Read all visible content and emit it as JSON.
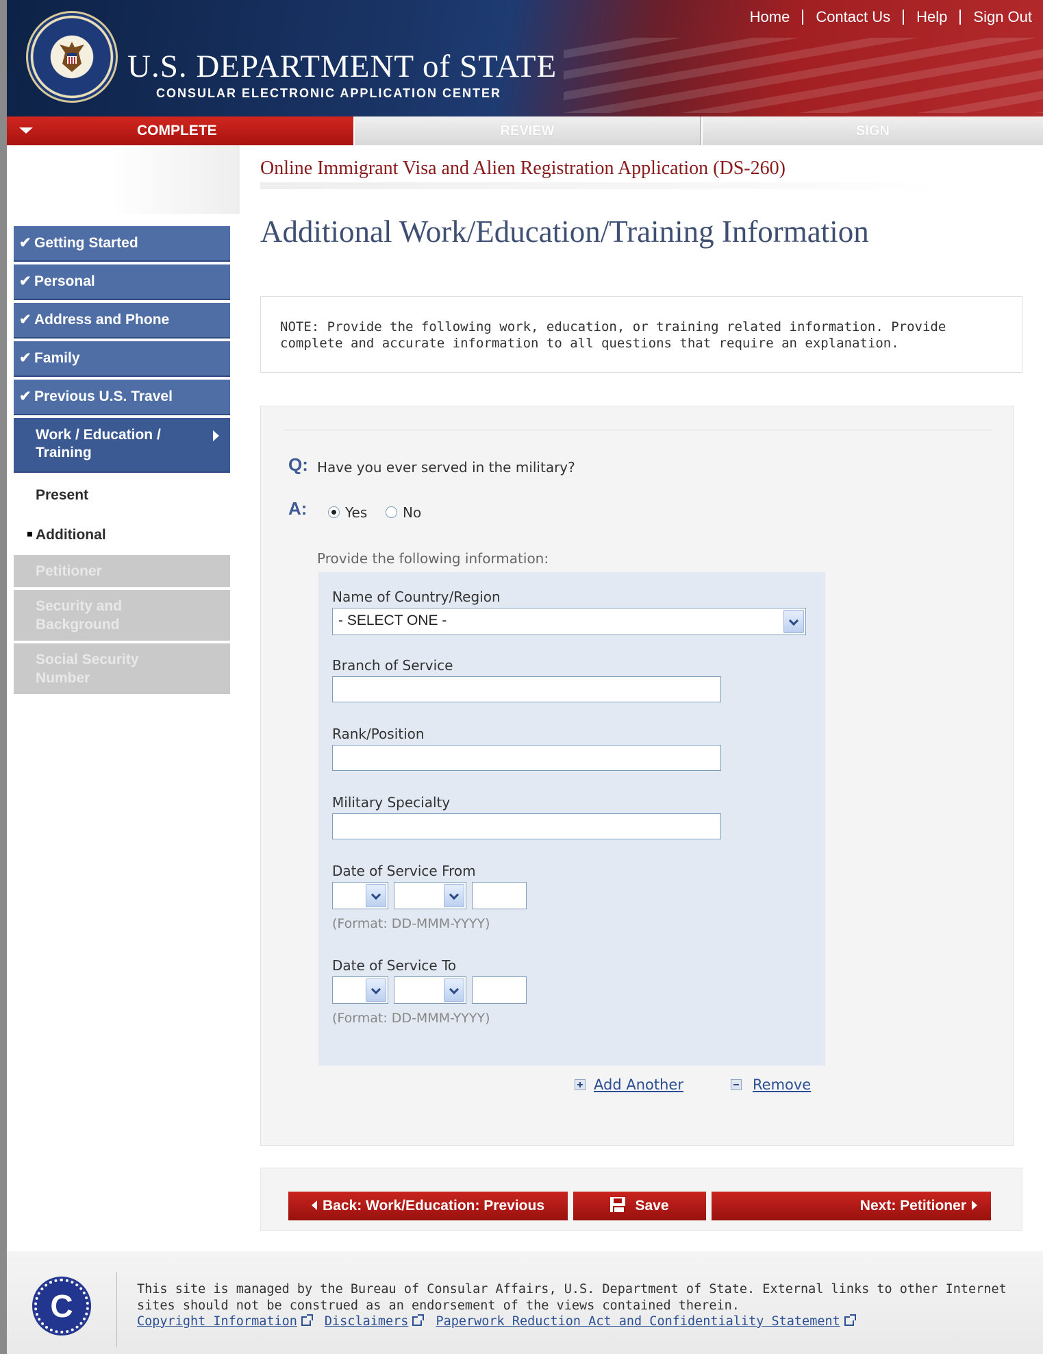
{
  "header": {
    "top_nav": [
      "Home",
      "Contact Us",
      "Help",
      "Sign Out"
    ],
    "brand_title": "U.S. DEPARTMENT of STATE",
    "brand_subtitle": "CONSULAR ELECTRONIC APPLICATION CENTER"
  },
  "progress": {
    "complete": "COMPLETE",
    "review": "REVIEW",
    "sign": "SIGN"
  },
  "sidebar": {
    "completed_items": [
      {
        "label": "Getting Started"
      },
      {
        "label": "Personal"
      },
      {
        "label": "Address and Phone"
      },
      {
        "label": "Family"
      },
      {
        "label": "Previous U.S. Travel"
      }
    ],
    "active_item": {
      "line1": "Work / Education /",
      "line2": "Training"
    },
    "sub_items": [
      "Present",
      "Additional"
    ],
    "disabled_items": [
      {
        "line1": "Petitioner",
        "line2": ""
      },
      {
        "line1": "Security and",
        "line2": "Background"
      },
      {
        "line1": "Social Security",
        "line2": "Number"
      }
    ]
  },
  "main": {
    "app_title": "Online Immigrant Visa and Alien Registration Application (DS-260)",
    "page_title": "Additional Work/Education/Training Information",
    "note_line1": "NOTE: Provide the following work, education, or training related information. Provide",
    "note_line2": "complete and accurate information to all questions that require an explanation.",
    "question_label": "Q:",
    "question": "Have you ever served in the military?",
    "answer_label": "A:",
    "answer_yes": "Yes",
    "answer_no": "No",
    "answer_selected": "Yes",
    "provide_info": "Provide the following information:",
    "fields": {
      "country_label": "Name of Country/Region",
      "country_value": "- SELECT ONE -",
      "branch_label": "Branch of Service",
      "branch_value": "",
      "rank_label": "Rank/Position",
      "rank_value": "",
      "specialty_label": "Military Specialty",
      "specialty_value": "",
      "from_label": "Date of Service From",
      "from_format": "(Format: DD-MMM-YYYY)",
      "to_label": "Date of Service To",
      "to_format": "(Format: DD-MMM-YYYY)"
    },
    "add_another": "Add Another",
    "remove": "Remove"
  },
  "buttons": {
    "back": "Back: Work/Education: Previous",
    "save": "Save",
    "next": "Next: Petitioner"
  },
  "footer": {
    "logo_letter": "C",
    "line1": "This site is managed by the Bureau of Consular Affairs, U.S. Department of State. External links to other Internet",
    "line2": "sites should not be construed as an endorsement of the views contained therein.",
    "links": [
      "Copyright Information",
      "Disclaimers",
      "Paperwork Reduction Act and Confidentiality Statement"
    ]
  }
}
